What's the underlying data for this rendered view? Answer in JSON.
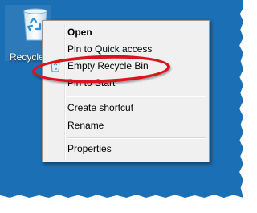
{
  "desktop": {
    "background_color": "#1b6fb5",
    "recycle_bin": {
      "label": "Recycle Bin",
      "icon": "recycle-bin-icon"
    }
  },
  "context_menu": {
    "items": [
      {
        "label": "Open",
        "bold": true
      },
      {
        "label": "Pin to Quick access"
      },
      {
        "label": "Empty Recycle Bin",
        "icon": "recycle-bin-empty-icon"
      },
      {
        "label": "Pin to Start"
      },
      {
        "label": "Create shortcut"
      },
      {
        "label": "Rename"
      },
      {
        "label": "Properties"
      }
    ]
  },
  "highlight": {
    "color": "#d9141d",
    "target": "Empty Recycle Bin"
  }
}
